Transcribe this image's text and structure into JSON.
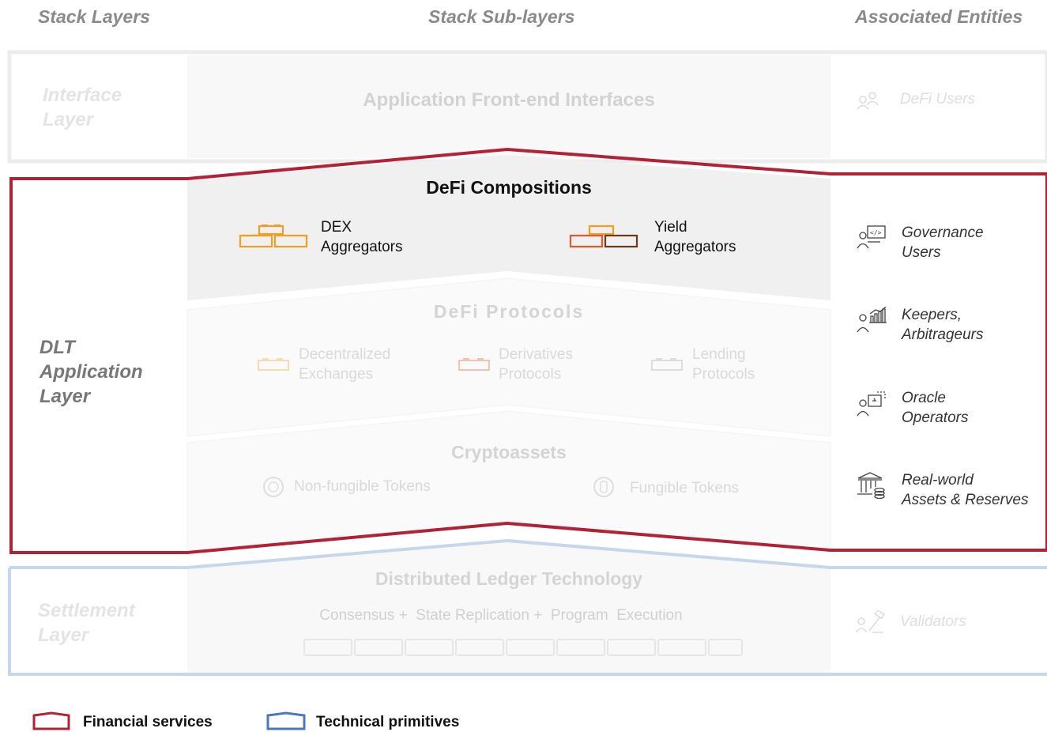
{
  "headers": {
    "stack_layers": "Stack Layers",
    "sub_layers": "Stack Sub-layers",
    "entities": "Associated Entities"
  },
  "interface_layer": {
    "name_line1": "Interface",
    "name_line2": "Layer",
    "sublayer": "Application Front-end Interfaces",
    "entity": "DeFi Users"
  },
  "application_layer": {
    "name_line1": "DLT",
    "name_line2": "Application",
    "name_line3": "Layer",
    "compositions": {
      "title": "DeFi Compositions",
      "items": [
        {
          "line1": "DEX",
          "line2": "Aggregators"
        },
        {
          "line1": "Yield",
          "line2": "Aggregators"
        }
      ]
    },
    "protocols": {
      "title": "DeFi Protocols",
      "items": [
        {
          "line1": "Decentralized",
          "line2": "Exchanges"
        },
        {
          "line1": "Derivatives",
          "line2": "Protocols"
        },
        {
          "line1": "Lending",
          "line2": "Protocols"
        }
      ]
    },
    "cryptoassets": {
      "title": "Cryptoassets",
      "items": [
        "Non-fungible Tokens",
        "Fungible Tokens"
      ]
    },
    "entities": [
      {
        "line1": "Governance",
        "line2": "Users",
        "icon": "governance-icon"
      },
      {
        "line1": "Keepers,",
        "line2": "Arbitrageurs",
        "icon": "keepers-icon"
      },
      {
        "line1": "Oracle",
        "line2": "Operators",
        "icon": "oracle-icon"
      },
      {
        "line1": "Real-world",
        "line2": "Assets & Reserves",
        "icon": "bank-icon"
      }
    ]
  },
  "settlement_layer": {
    "name_line1": "Settlement",
    "name_line2": "Layer",
    "title": "Distributed Ledger Technology",
    "subtitle": "Consensus +  State Replication +  Program  Execution",
    "entity": "Validators"
  },
  "legend": {
    "financial": "Financial services",
    "technical": "Technical primitives"
  },
  "colors": {
    "financial_red": "#b22234",
    "technical_blue": "#4a78c0",
    "orange": "#f0a020",
    "red_orange": "#e05a2a",
    "brown": "#6b3a1e"
  }
}
